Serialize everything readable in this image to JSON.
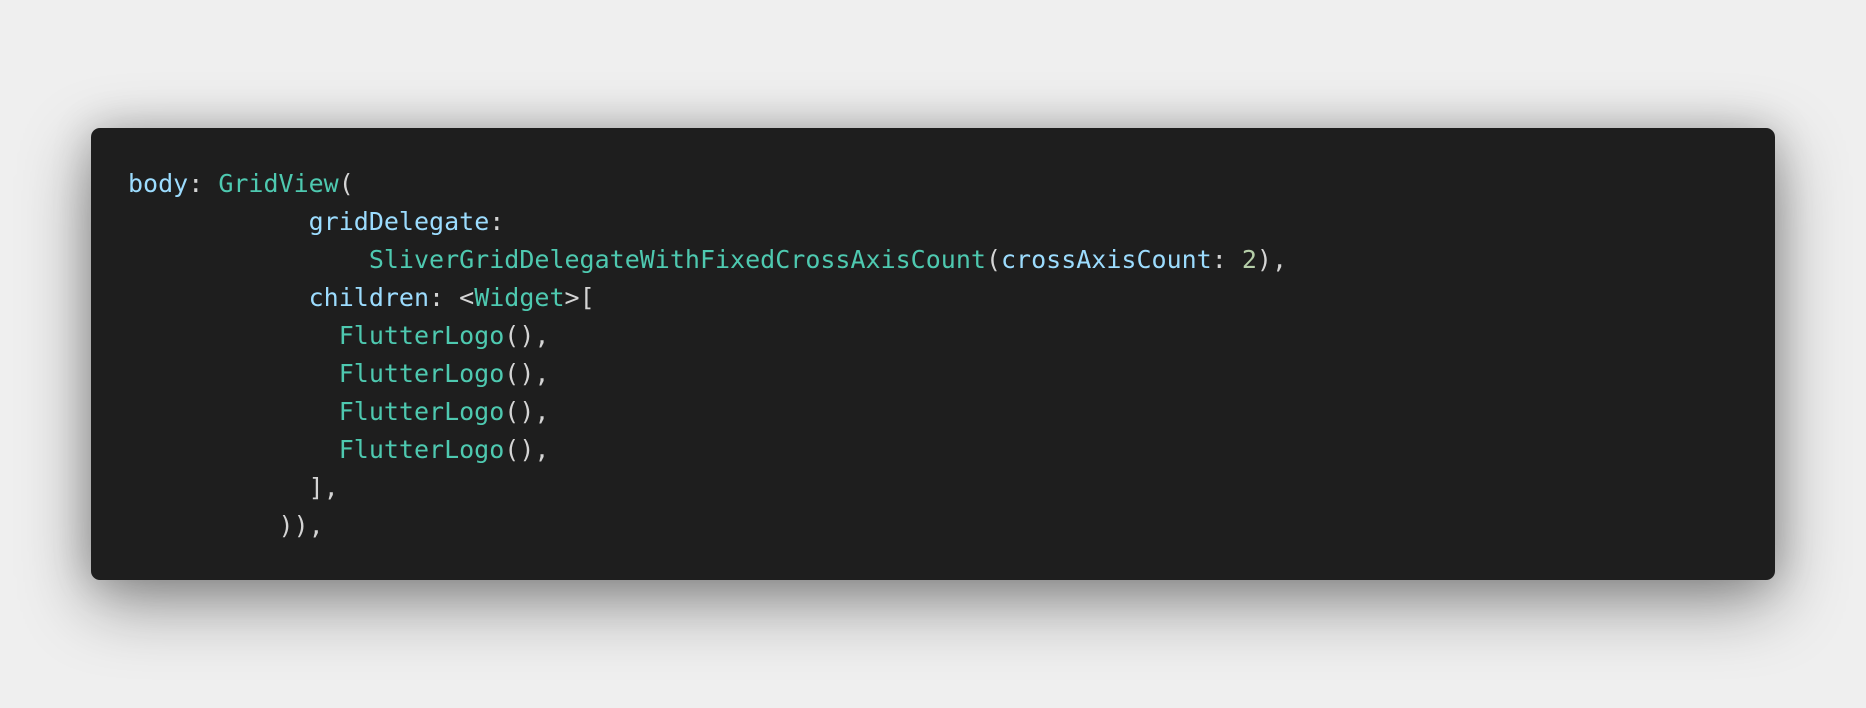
{
  "code_block": {
    "theme": {
      "background": "#1e1e1e",
      "page_background": "#efefef",
      "property_color": "#9cdcfe",
      "type_color": "#4ec9b0",
      "number_color": "#b5cea8",
      "punctuation_color": "#d4d4d4"
    },
    "lines": [
      [
        {
          "t": "body",
          "k": "prop"
        },
        {
          "t": ": ",
          "k": "punc"
        },
        {
          "t": "GridView",
          "k": "type"
        },
        {
          "t": "(",
          "k": "punc"
        }
      ],
      [
        {
          "t": "            ",
          "k": "punc"
        },
        {
          "t": "gridDelegate",
          "k": "prop"
        },
        {
          "t": ":",
          "k": "punc"
        }
      ],
      [
        {
          "t": "                ",
          "k": "punc"
        },
        {
          "t": "SliverGridDelegateWithFixedCrossAxisCount",
          "k": "type"
        },
        {
          "t": "(",
          "k": "punc"
        },
        {
          "t": "crossAxisCount",
          "k": "prop"
        },
        {
          "t": ": ",
          "k": "punc"
        },
        {
          "t": "2",
          "k": "num"
        },
        {
          "t": "),",
          "k": "punc"
        }
      ],
      [
        {
          "t": "            ",
          "k": "punc"
        },
        {
          "t": "children",
          "k": "prop"
        },
        {
          "t": ": <",
          "k": "punc"
        },
        {
          "t": "Widget",
          "k": "type"
        },
        {
          "t": ">[",
          "k": "punc"
        }
      ],
      [
        {
          "t": "              ",
          "k": "punc"
        },
        {
          "t": "FlutterLogo",
          "k": "type"
        },
        {
          "t": "(),",
          "k": "punc"
        }
      ],
      [
        {
          "t": "              ",
          "k": "punc"
        },
        {
          "t": "FlutterLogo",
          "k": "type"
        },
        {
          "t": "(),",
          "k": "punc"
        }
      ],
      [
        {
          "t": "              ",
          "k": "punc"
        },
        {
          "t": "FlutterLogo",
          "k": "type"
        },
        {
          "t": "(),",
          "k": "punc"
        }
      ],
      [
        {
          "t": "              ",
          "k": "punc"
        },
        {
          "t": "FlutterLogo",
          "k": "type"
        },
        {
          "t": "(),",
          "k": "punc"
        }
      ],
      [
        {
          "t": "            ",
          "k": "punc"
        },
        {
          "t": "],",
          "k": "punc"
        }
      ],
      [
        {
          "t": "          ",
          "k": "punc"
        },
        {
          "t": ")),",
          "k": "punc"
        }
      ]
    ]
  }
}
